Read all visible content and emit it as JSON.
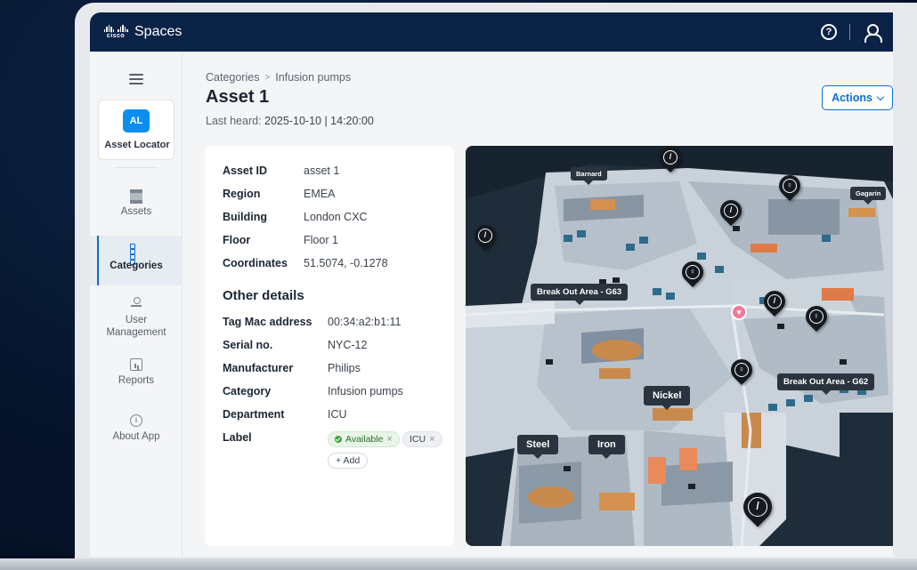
{
  "header": {
    "brand_logo": "cisco",
    "app_title": "Spaces",
    "help_icon": "help-circle-icon",
    "user_icon": "user-icon"
  },
  "sidebar": {
    "app_badge": "AL",
    "app_name": "Asset Locator",
    "items": [
      {
        "label": "Assets",
        "icon": "assets-icon",
        "active": false
      },
      {
        "label": "Categories",
        "icon": "categories-icon",
        "active": true
      },
      {
        "label": "User Management",
        "icon": "user-management-icon",
        "active": false
      },
      {
        "label": "Reports",
        "icon": "reports-icon",
        "active": false
      },
      {
        "label": "About App",
        "icon": "info-icon",
        "active": false
      }
    ]
  },
  "breadcrumb": {
    "root": "Categories",
    "separator": ">",
    "current": "Infusion pumps"
  },
  "page": {
    "title": "Asset 1",
    "last_heard_label": "Last heard:",
    "last_heard_value": "2025-10-10 | 14:20:00",
    "actions_label": "Actions"
  },
  "details": {
    "rows": [
      {
        "key": "Asset ID",
        "value": "asset 1"
      },
      {
        "key": "Region",
        "value": "EMEA"
      },
      {
        "key": "Building",
        "value": "London CXC"
      },
      {
        "key": "Floor",
        "value": "Floor 1"
      },
      {
        "key": "Coordinates",
        "value": "51.5074, -0.1278"
      }
    ],
    "other_heading": "Other details",
    "other_rows": [
      {
        "key": "Tag Mac address",
        "value": "00:34:a2:b1:11"
      },
      {
        "key": "Serial no.",
        "value": "NYC-12"
      },
      {
        "key": "Manufacturer",
        "value": "Philips"
      },
      {
        "key": "Category",
        "value": "Infusion pumps"
      },
      {
        "key": "Department",
        "value": "ICU"
      }
    ],
    "label_key": "Label",
    "chips": [
      "Available",
      "ICU"
    ],
    "add_label": "+ Add",
    "colors": {
      "available": "#3ea63b",
      "accent": "#0a6fd6"
    }
  },
  "map": {
    "labels": [
      "Barnard",
      "Gagarin",
      "Break Out Area - G63",
      "Break Out Area - G62",
      "Nickel",
      "Steel",
      "Iron"
    ]
  }
}
